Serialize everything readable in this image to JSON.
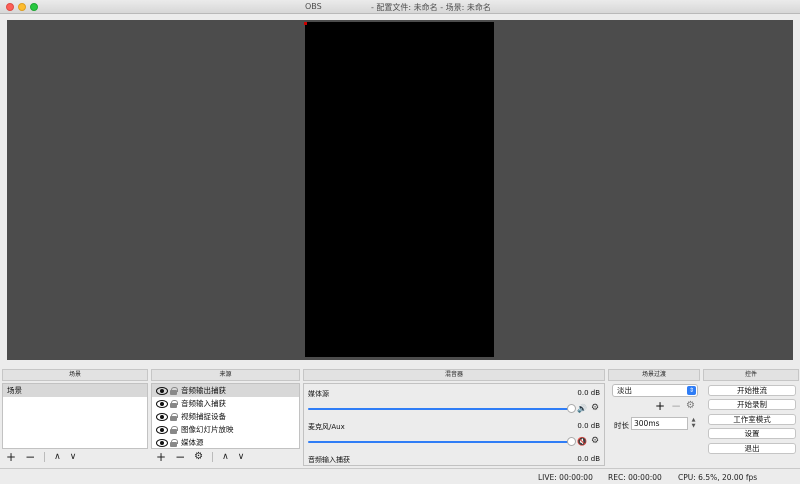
{
  "window": {
    "app_name": "OBS",
    "title": "- 配置文件: 未命名 - 场景: 未命名"
  },
  "docks": {
    "scenes": "场景",
    "sources": "来源",
    "mixer": "混音器",
    "transitions": "场景过渡",
    "controls": "控件"
  },
  "scenes": {
    "items": [
      {
        "label": "场景",
        "selected": true
      }
    ]
  },
  "sources": {
    "items": [
      {
        "label": "音频输出捕获",
        "selected": true
      },
      {
        "label": "音频输入捕获"
      },
      {
        "label": "视频捕捉设备"
      },
      {
        "label": "图像幻灯片放映"
      },
      {
        "label": "媒体源"
      }
    ]
  },
  "mixer": {
    "channels": [
      {
        "name": "媒体源",
        "db": "0.0 dB",
        "level": 1.0,
        "muted": false
      },
      {
        "name": "麦克风/Aux",
        "db": "0.0 dB",
        "level": 1.0,
        "muted": true
      },
      {
        "name": "音频输入捕获",
        "db": "0.0 dB"
      }
    ]
  },
  "transitions": {
    "selected": "淡出",
    "duration_label": "时长",
    "duration_value": "300ms"
  },
  "controls": {
    "start_stream": "开始推流",
    "start_record": "开始录制",
    "studio_mode": "工作室模式",
    "settings": "设置",
    "exit": "退出"
  },
  "status": {
    "live": "LIVE: 00:00:00",
    "rec": "REC: 00:00:00",
    "cpu": "CPU: 6.5%, 20.00 fps"
  },
  "icons": {
    "add": "+",
    "remove": "−",
    "up": "∧",
    "down": "∨",
    "gear": "⚙",
    "speaker": "🔊",
    "muted": "🔇"
  },
  "colors": {
    "accent": "#2f7df6",
    "preview_bg": "#4c4c4c",
    "muted_red": "#d11f1f"
  }
}
